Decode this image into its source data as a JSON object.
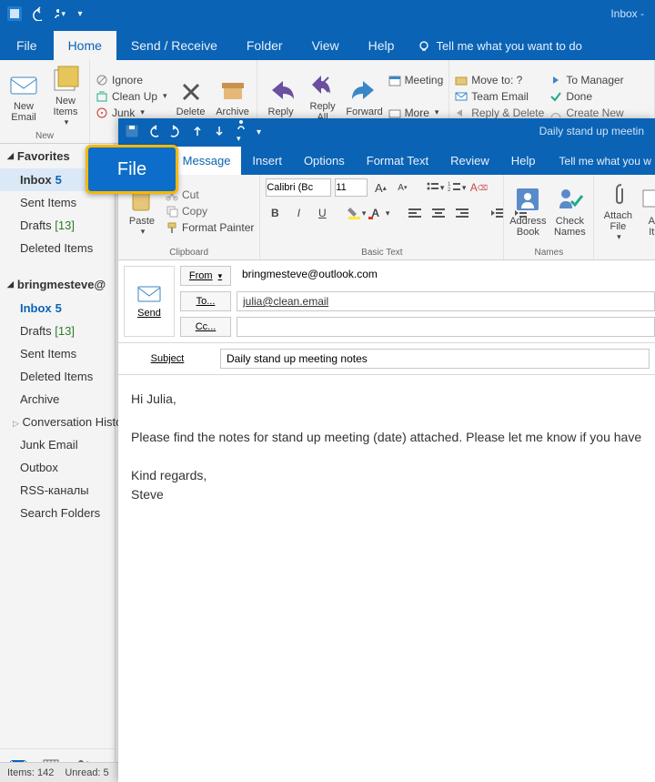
{
  "main": {
    "title": "Inbox - ",
    "qat": {
      "undo_tip": "Undo"
    },
    "tabs": {
      "file": "File",
      "home": "Home",
      "send_receive": "Send / Receive",
      "folder": "Folder",
      "view": "View",
      "help": "Help",
      "tellme": "Tell me what you want to do"
    },
    "ribbon": {
      "new_group": {
        "new_email": "New\nEmail",
        "new_items": "New\nItems",
        "label": "New"
      },
      "delete_group": {
        "ignore": "Ignore",
        "cleanup": "Clean Up",
        "junk": "Junk",
        "delete": "Delete",
        "archive": "Archive"
      },
      "respond_group": {
        "reply": "Reply",
        "reply_all": "Reply\nAll",
        "forward": "Forward",
        "meeting": "Meeting",
        "more": "More"
      },
      "quick_group": {
        "move_to": "Move to: ?",
        "team_email": "Team Email",
        "reply_delete": "Reply & Delete",
        "to_manager": "To Manager",
        "done": "Done",
        "create_new": "Create New"
      }
    }
  },
  "sidebar": {
    "favorites_label": "Favorites",
    "favorites": [
      {
        "label": "Inbox",
        "count": "5"
      },
      {
        "label": "Sent Items"
      },
      {
        "label": "Drafts",
        "bracket": "[13]"
      },
      {
        "label": "Deleted Items"
      }
    ],
    "account_label": "bringmesteve@",
    "account_items": [
      {
        "label": "Inbox",
        "count": "5"
      },
      {
        "label": "Drafts",
        "bracket": "[13]"
      },
      {
        "label": "Sent Items"
      },
      {
        "label": "Deleted Items"
      },
      {
        "label": "Archive"
      },
      {
        "label": "Conversation Histor"
      },
      {
        "label": "Junk Email"
      },
      {
        "label": "Outbox"
      },
      {
        "label": "RSS-каналы"
      },
      {
        "label": "Search Folders"
      }
    ]
  },
  "status": {
    "items": "Items: 142",
    "unread": "Unread: 5"
  },
  "compose": {
    "title": "Daily stand up meetin",
    "tabs": {
      "file": "File",
      "message": "Message",
      "insert": "Insert",
      "options": "Options",
      "format_text": "Format Text",
      "review": "Review",
      "help": "Help",
      "tellme": "Tell me what you w"
    },
    "ribbon": {
      "clipboard": {
        "paste": "Paste",
        "cut": "Cut",
        "copy": "Copy",
        "format_painter": "Format Painter",
        "label": "Clipboard"
      },
      "basic_text": {
        "font": "Calibri (Bc",
        "size": "11",
        "label": "Basic Text"
      },
      "names": {
        "address_book": "Address\nBook",
        "check_names": "Check\nNames",
        "label": "Names"
      },
      "include": {
        "attach_file": "Attach\nFile",
        "attach_item": "Att\nIte"
      }
    },
    "header": {
      "send": "Send",
      "from_btn": "From",
      "to_btn": "To...",
      "cc_btn": "Cc...",
      "subject_label": "Subject",
      "from_value": "bringmesteve@outlook.com",
      "to_value": "julia@clean.email",
      "cc_value": "",
      "subject_value": "Daily stand up meeting notes"
    },
    "body": "Hi Julia,\n\nPlease find the notes for stand up meeting (date) attached. Please let me know if you have \n\nKind regards,\nSteve"
  },
  "callout": {
    "file": "File"
  }
}
